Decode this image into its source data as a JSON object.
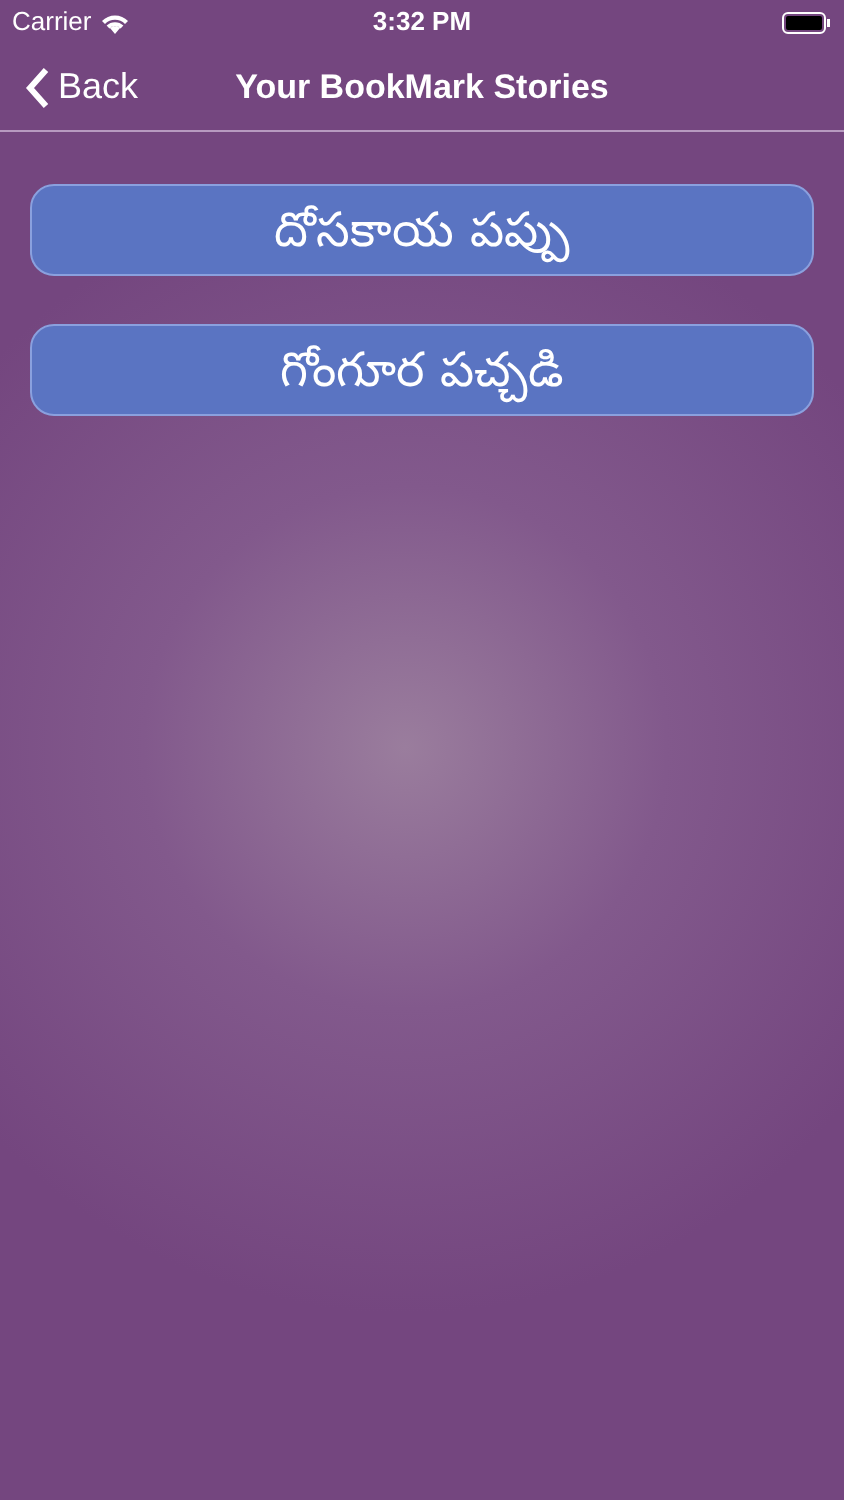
{
  "status_bar": {
    "carrier": "Carrier",
    "time": "3:32 PM"
  },
  "nav_bar": {
    "back": "Back",
    "title": "Your BookMark Stories"
  },
  "stories": [
    {
      "title": "దోసకాయ పప్పు"
    },
    {
      "title": "గోంగూర పచ్చడి"
    }
  ]
}
